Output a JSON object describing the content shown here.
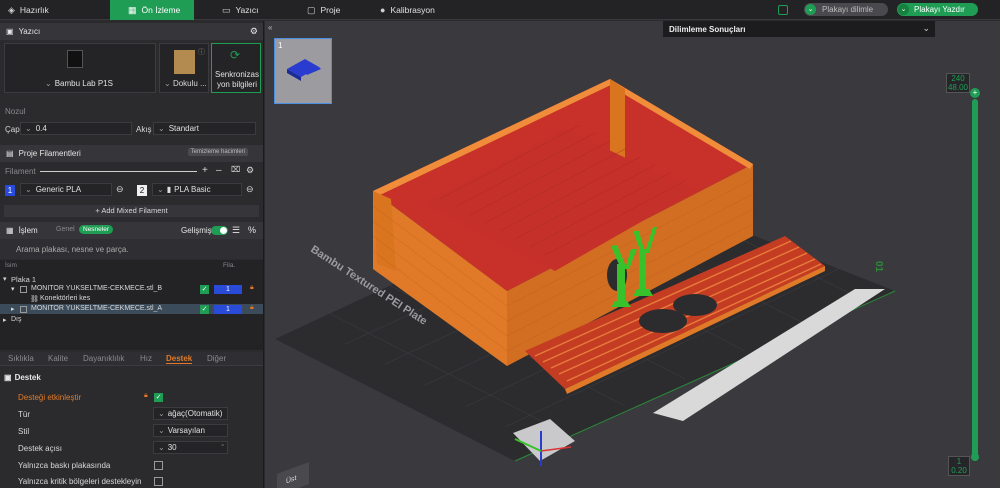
{
  "topbar": {
    "tabs": [
      "Hazırlık",
      "Ön İzleme",
      "Yazıcı",
      "Proje",
      "Kalibrasyon"
    ],
    "slice_label": "Plakayı dilimle",
    "print_label": "Plakayı Yazdır"
  },
  "printer": {
    "section_title": "Yazıcı",
    "printer_name": "Bambu Lab P1S",
    "plate_label": "Dokulu ...",
    "sync_label_1": "Senkronizas",
    "sync_label_2": "yon bilgileri",
    "nozzle_label": "Nozul",
    "diameter_label": "Çap",
    "diameter_value": "0.4",
    "flow_label": "Akış",
    "flow_value": "Standart"
  },
  "filaments": {
    "section_title": "Proje Filamentleri",
    "edit_badge": "Temizleme hacimleri",
    "filament_label": "Filament",
    "items": [
      {
        "index": "1",
        "name": "Generic PLA",
        "color": "#2a4bd7"
      },
      {
        "index": "2",
        "name": "PLA Basic",
        "color": "#f0f0f0"
      }
    ],
    "add_mixed": "+ Add Mixed Filament"
  },
  "process": {
    "section_title": "İşlem",
    "tab_global": "Genel",
    "tab_objects": "Nesneler",
    "advanced_label": "Gelişmiş",
    "search_placeholder": "Arama plakası, nesne ve parça.",
    "col_name": "İsim",
    "col_fil": "Fila.",
    "tree": {
      "plate": "Plaka 1",
      "obj_b": "MONITOR YUKSELTME-CEKMECE.stl_B",
      "obj_b_fil": "1",
      "connectors": "Konektörleri kes",
      "obj_a": "MONITOR YUKSELTME-CEKMECE.stl_A",
      "obj_a_fil": "1",
      "outside": "Dış"
    }
  },
  "settings_tabs": [
    "Sıklıkla",
    "Kalite",
    "Dayanıklılık",
    "Hız",
    "Destek",
    "Diğer"
  ],
  "support": {
    "title": "Destek",
    "enable_label": "Desteği etkinleştir",
    "type_label": "Tür",
    "type_value": "ağaç(Otomatik)",
    "style_label": "Stil",
    "style_value": "Varsayılan",
    "angle_label": "Destek açısı",
    "angle_value": "30",
    "angle_unit": "°",
    "plate_only_label": "Yalnızca baskı plakasında",
    "critical_only_label": "Yalnızca kritik bölgeleri destekleyin"
  },
  "viewport": {
    "results_label": "Dilimleme Sonuçları",
    "plate_thumb_number": "1",
    "bed_label": "Bambu Textured PEI Plate",
    "bed_number": "01",
    "layer_top_1": "240",
    "layer_top_2": "48.00",
    "layer_bottom_1": "1",
    "layer_bottom_2": "0.20",
    "corner_label": "Üst"
  },
  "colors": {
    "accent": "#1f9d55",
    "orange": "#e07a28",
    "red": "#c8302a",
    "support_green": "#37c22b"
  }
}
